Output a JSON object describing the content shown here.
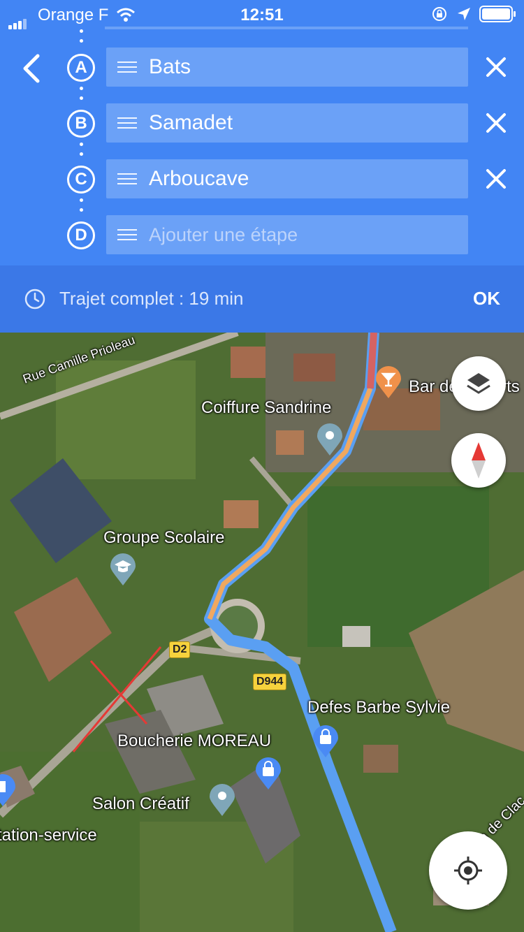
{
  "status_bar": {
    "carrier": "Orange F",
    "time": "12:51"
  },
  "route": {
    "stops": [
      {
        "letter": "A",
        "name": "Bats"
      },
      {
        "letter": "B",
        "name": "Samadet"
      },
      {
        "letter": "C",
        "name": "Arboucave"
      },
      {
        "letter": "D",
        "placeholder": "Ajouter une étape"
      }
    ],
    "duration": "Trajet complet : 19 min",
    "ok_label": "OK"
  },
  "map": {
    "street_label": "Rue Camille Prioleau",
    "places": {
      "coiffure": "Coiffure Sandrine",
      "bar": "Bar des Sports",
      "groupe": "Groupe Scolaire",
      "defes": "Defes Barbe Sylvie",
      "boucherie": "Boucherie MOREAU",
      "salon": "Salon Créatif",
      "station": "Station-service",
      "chemin": "Chemin de Clac"
    },
    "road_signs": {
      "d2": "D2",
      "d944": "D944"
    }
  },
  "colors": {
    "header": "#4285f4",
    "duration_bar": "#3b78e7",
    "route": "#5a9ff2",
    "route_highlight": "#f0a860"
  }
}
